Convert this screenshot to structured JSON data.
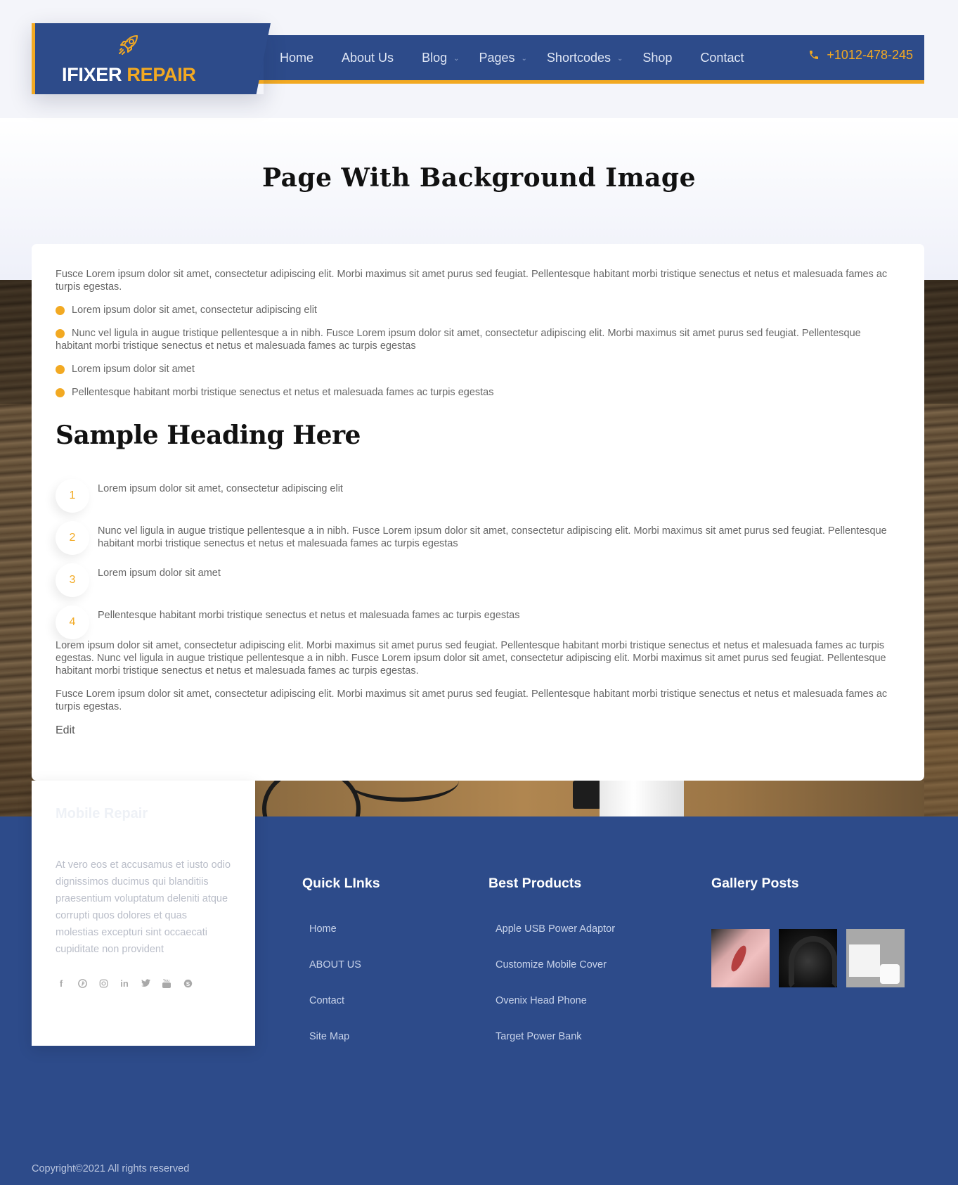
{
  "header": {
    "logo": {
      "text_main": "IFIXER",
      "text_accent": "REPAIR",
      "icon": "rocket-icon"
    },
    "nav": [
      {
        "label": "Home",
        "has_dropdown": false
      },
      {
        "label": "About Us",
        "has_dropdown": false
      },
      {
        "label": "Blog",
        "has_dropdown": true
      },
      {
        "label": "Pages",
        "has_dropdown": true
      },
      {
        "label": "Shortcodes",
        "has_dropdown": true
      },
      {
        "label": "Shop",
        "has_dropdown": false
      },
      {
        "label": "Contact",
        "has_dropdown": false
      }
    ],
    "phone": {
      "icon": "phone-icon",
      "number": "+1012-478-245"
    }
  },
  "page": {
    "title": "Page With Background Image"
  },
  "content": {
    "intro": "Fusce Lorem ipsum dolor sit amet, consectetur adipiscing elit. Morbi maximus sit amet purus sed feugiat. Pellentesque habitant morbi tristique senectus et netus et malesuada fames ac turpis egestas.",
    "bullets": [
      "Lorem ipsum dolor sit amet, consectetur adipiscing elit",
      "Nunc vel ligula in augue tristique pellentesque a in nibh. Fusce Lorem ipsum dolor sit amet, consectetur adipiscing elit. Morbi maximus sit amet purus sed feugiat. Pellentesque habitant morbi tristique senectus et netus et malesuada fames ac turpis egestas",
      "Lorem ipsum dolor sit amet",
      "Pellentesque habitant morbi tristique senectus et netus et malesuada fames ac turpis egestas"
    ],
    "heading": "Sample Heading Here",
    "numbered": [
      {
        "num": "1",
        "text": "Lorem ipsum dolor sit amet, consectetur adipiscing elit"
      },
      {
        "num": "2",
        "text": "Nunc vel ligula in augue tristique pellentesque a in nibh. Fusce Lorem ipsum dolor sit amet, consectetur adipiscing elit. Morbi maximus sit amet purus sed feugiat. Pellentesque habitant morbi tristique senectus et netus et malesuada fames ac turpis egestas"
      },
      {
        "num": "3",
        "text": "Lorem ipsum dolor sit amet"
      },
      {
        "num": "4",
        "text": "Pellentesque habitant morbi tristique senectus et netus et malesuada fames ac turpis egestas"
      }
    ],
    "para1": "Lorem ipsum dolor sit amet, consectetur adipiscing elit. Morbi maximus sit amet purus sed feugiat. Pellentesque habitant morbi tristique senectus et netus et malesuada fames ac turpis egestas. Nunc vel ligula in augue tristique pellentesque a in nibh. Fusce Lorem ipsum dolor sit amet, consectetur adipiscing elit. Morbi maximus sit amet purus sed feugiat. Pellentesque habitant morbi tristique senectus et netus et malesuada fames ac turpis egestas.",
    "para2": "Fusce Lorem ipsum dolor sit amet, consectetur adipiscing elit. Morbi maximus sit amet purus sed feugiat. Pellentesque habitant morbi tristique senectus et netus et malesuada fames ac turpis egestas.",
    "edit_label": "Edit"
  },
  "footer": {
    "about": {
      "title": "Mobile Repair",
      "text": "At vero eos et accusamus et iusto odio dignissimos ducimus qui blanditiis praesentium voluptatum deleniti atque corrupti quos dolores et quas molestias excepturi sint occaecati cupiditate non provident",
      "socials": [
        {
          "name": "facebook-icon",
          "glyph": "f"
        },
        {
          "name": "pinterest-icon",
          "glyph": "℗"
        },
        {
          "name": "instagram-icon",
          "glyph": "◎"
        },
        {
          "name": "linkedin-icon",
          "glyph": "in"
        },
        {
          "name": "twitter-icon",
          "glyph": "🐦"
        },
        {
          "name": "youtube-icon",
          "glyph": "▣"
        },
        {
          "name": "skype-icon",
          "glyph": "S"
        }
      ]
    },
    "quick_links": {
      "title": "Quick LInks",
      "items": [
        "Home",
        "ABOUT US",
        "Contact",
        "Site Map"
      ]
    },
    "best_products": {
      "title": "Best Products",
      "items": [
        "Apple USB Power Adaptor",
        "Customize Mobile Cover",
        "Ovenix Head Phone",
        "Target Power Bank"
      ]
    },
    "gallery": {
      "title": "Gallery Posts",
      "items": [
        "pink-phone-case-thumbnail",
        "headphones-thumbnail",
        "usb-power-adaptor-thumbnail"
      ]
    },
    "copyright": "Copyright©2021 All rights reserved"
  },
  "colors": {
    "brand_blue": "#2d4b8a",
    "accent_orange": "#f2a922",
    "page_bg": "#f4f5fa"
  }
}
